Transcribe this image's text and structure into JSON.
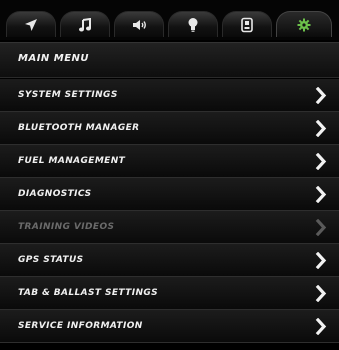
{
  "tabs": [
    {
      "name": "navigation-arrow-icon"
    },
    {
      "name": "music-note-icon"
    },
    {
      "name": "speaker-volume-icon"
    },
    {
      "name": "light-bulb-icon"
    },
    {
      "name": "device-icon"
    },
    {
      "name": "gear-settings-icon",
      "active": true,
      "color": "#6cc04a"
    }
  ],
  "menu": {
    "title": "MAIN MENU",
    "items": [
      {
        "label": "SYSTEM SETTINGS",
        "enabled": true
      },
      {
        "label": "BLUETOOTH MANAGER",
        "enabled": true
      },
      {
        "label": "FUEL MANAGEMENT",
        "enabled": true
      },
      {
        "label": "DIAGNOSTICS",
        "enabled": true
      },
      {
        "label": "TRAINING VIDEOS",
        "enabled": false
      },
      {
        "label": "GPS STATUS",
        "enabled": true
      },
      {
        "label": "TAB & BALLAST SETTINGS",
        "enabled": true
      },
      {
        "label": "SERVICE INFORMATION",
        "enabled": true
      }
    ]
  }
}
